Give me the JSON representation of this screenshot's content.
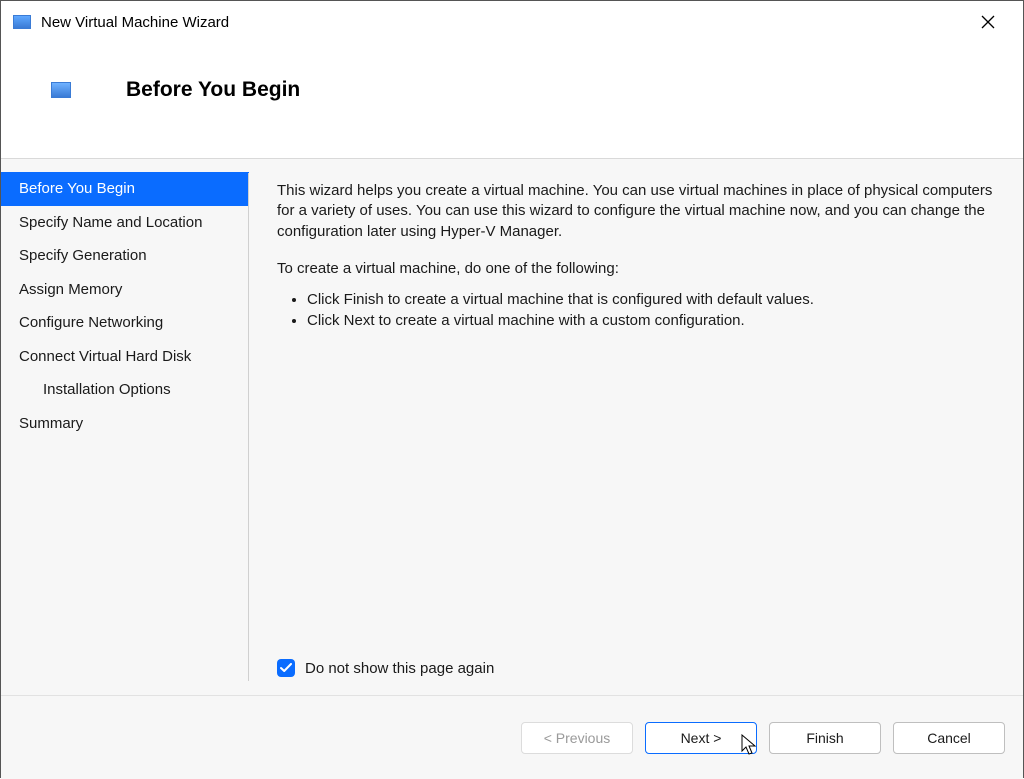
{
  "window": {
    "title": "New Virtual Machine Wizard"
  },
  "header": {
    "title": "Before You Begin"
  },
  "sidebar": {
    "items": [
      {
        "label": "Before You Begin",
        "selected": true,
        "indent": false
      },
      {
        "label": "Specify Name and Location",
        "selected": false,
        "indent": false
      },
      {
        "label": "Specify Generation",
        "selected": false,
        "indent": false
      },
      {
        "label": "Assign Memory",
        "selected": false,
        "indent": false
      },
      {
        "label": "Configure Networking",
        "selected": false,
        "indent": false
      },
      {
        "label": "Connect Virtual Hard Disk",
        "selected": false,
        "indent": false
      },
      {
        "label": "Installation Options",
        "selected": false,
        "indent": true
      },
      {
        "label": "Summary",
        "selected": false,
        "indent": false
      }
    ]
  },
  "content": {
    "intro": "This wizard helps you create a virtual machine. You can use virtual machines in place of physical computers for a variety of uses. You can use this wizard to configure the virtual machine now, and you can change the configuration later using Hyper-V Manager.",
    "lead": "To create a virtual machine, do one of the following:",
    "bullets": [
      "Click Finish to create a virtual machine that is configured with default values.",
      "Click Next to create a virtual machine with a custom configuration."
    ],
    "checkbox_label": "Do not show this page again",
    "checkbox_checked": true
  },
  "footer": {
    "previous": "< Previous",
    "next": "Next >",
    "finish": "Finish",
    "cancel": "Cancel"
  }
}
